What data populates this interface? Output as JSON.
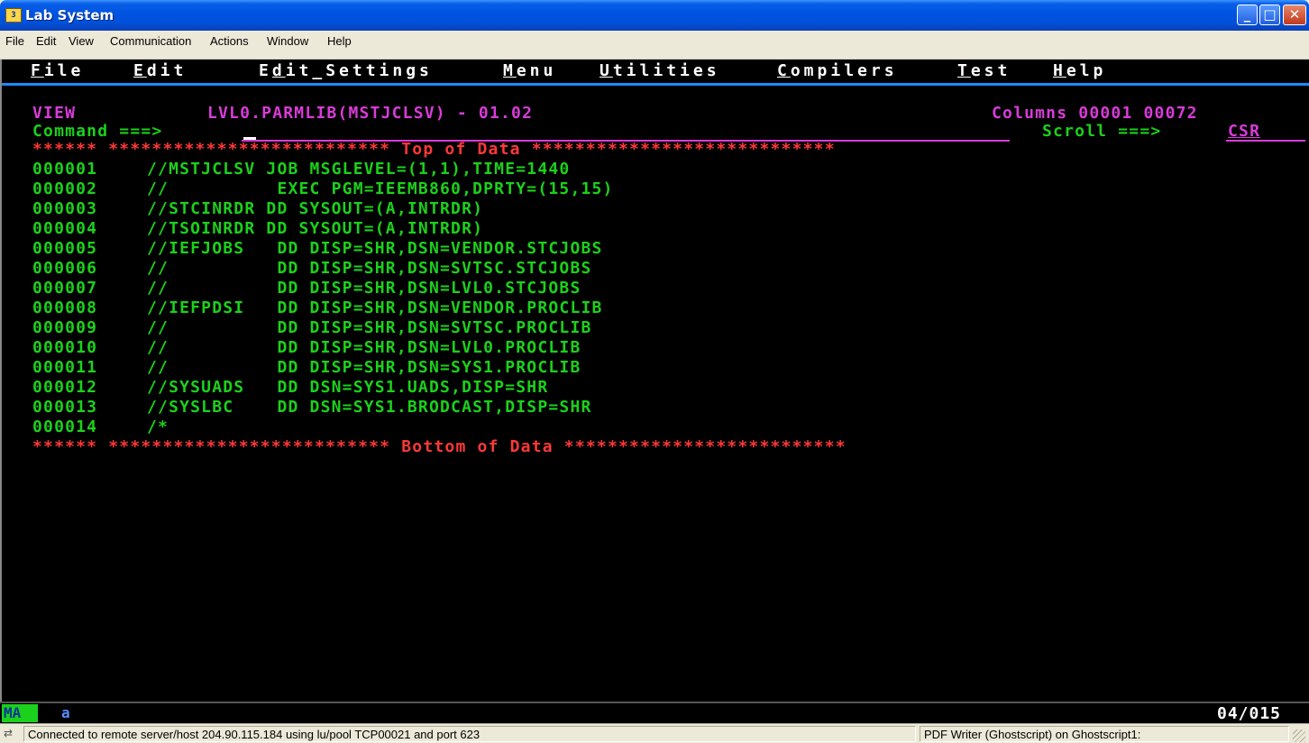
{
  "window": {
    "title": "Lab System",
    "icon": "terminal-app-icon",
    "controls": [
      "minimize",
      "maximize",
      "close"
    ]
  },
  "host_menu": [
    "File",
    "Edit",
    "View",
    "Communication",
    "Actions",
    "Window",
    "Help"
  ],
  "ispf_menu": [
    "File",
    "Edit",
    "Edit_Settings",
    "Menu",
    "Utilities",
    "Compilers",
    "Test",
    "Help"
  ],
  "editor": {
    "mode": "VIEW",
    "dataset": "LVL0.PARMLIB(MSTJCLSV) - 01.02",
    "columns": "Columns 00001 00072",
    "command_label": "Command ===>",
    "command_value": "",
    "scroll_label": "Scroll ===>",
    "scroll_value": "CSR",
    "top_marker": "****** ************************** Top of Data ****************************",
    "bottom_marker": "****** ************************** Bottom of Data **************************",
    "lines": [
      {
        "num": "000001",
        "text": "//MSTJCLSV JOB MSGLEVEL=(1,1),TIME=1440"
      },
      {
        "num": "000002",
        "text": "//          EXEC PGM=IEEMB860,DPRTY=(15,15)"
      },
      {
        "num": "000003",
        "text": "//STCINRDR DD SYSOUT=(A,INTRDR)"
      },
      {
        "num": "000004",
        "text": "//TSOINRDR DD SYSOUT=(A,INTRDR)"
      },
      {
        "num": "000005",
        "text": "//IEFJOBS   DD DISP=SHR,DSN=VENDOR.STCJOBS"
      },
      {
        "num": "000006",
        "text": "//          DD DISP=SHR,DSN=SVTSC.STCJOBS"
      },
      {
        "num": "000007",
        "text": "//          DD DISP=SHR,DSN=LVL0.STCJOBS"
      },
      {
        "num": "000008",
        "text": "//IEFPDSI   DD DISP=SHR,DSN=VENDOR.PROCLIB"
      },
      {
        "num": "000009",
        "text": "//          DD DISP=SHR,DSN=SVTSC.PROCLIB"
      },
      {
        "num": "000010",
        "text": "//          DD DISP=SHR,DSN=LVL0.PROCLIB"
      },
      {
        "num": "000011",
        "text": "//          DD DISP=SHR,DSN=SYS1.PROCLIB"
      },
      {
        "num": "000012",
        "text": "//SYSUADS   DD DSN=SYS1.UADS,DISP=SHR"
      },
      {
        "num": "000013",
        "text": "//SYSLBC    DD DSN=SYS1.BRODCAST,DISP=SHR"
      },
      {
        "num": "000014",
        "text": "/*"
      }
    ]
  },
  "oia": {
    "indicator": "MA",
    "session": "a",
    "cursor_pos": "04/015"
  },
  "status": {
    "left": "Connected to remote server/host 204.90.115.184 using lu/pool TCP00021 and port 623",
    "right": "PDF Writer (Ghostscript) on Ghostscript1:"
  },
  "colors": {
    "title_bar": "#0054e3",
    "terminal_bg": "#000000",
    "text_green": "#1bd11b",
    "text_magenta": "#d93bd9",
    "text_red": "#ff3838",
    "text_white": "#ffffff",
    "divider_blue": "#1a8cff"
  }
}
